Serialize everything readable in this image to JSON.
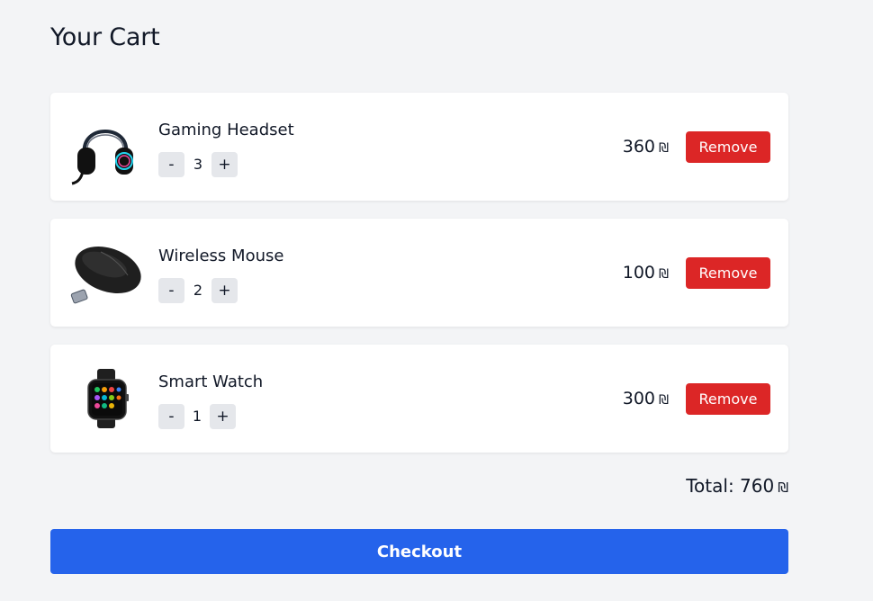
{
  "page": {
    "title": "Your Cart"
  },
  "colors": {
    "accent": "#2563eb",
    "danger": "#dc2626",
    "background": "#f3f4f6"
  },
  "cart": {
    "items": [
      {
        "name": "Gaming Headset",
        "image_icon": "headset-image",
        "quantity": "3",
        "price": "360",
        "currency": "₪",
        "decrement_label": "-",
        "increment_label": "+",
        "remove_label": "Remove"
      },
      {
        "name": "Wireless Mouse",
        "image_icon": "mouse-image",
        "quantity": "2",
        "price": "100",
        "currency": "₪",
        "decrement_label": "-",
        "increment_label": "+",
        "remove_label": "Remove"
      },
      {
        "name": "Smart Watch",
        "image_icon": "smartwatch-image",
        "quantity": "1",
        "price": "300",
        "currency": "₪",
        "decrement_label": "-",
        "increment_label": "+",
        "remove_label": "Remove"
      }
    ],
    "total_label": "Total:",
    "total_value": "760",
    "total_currency": "₪",
    "checkout_label": "Checkout"
  }
}
